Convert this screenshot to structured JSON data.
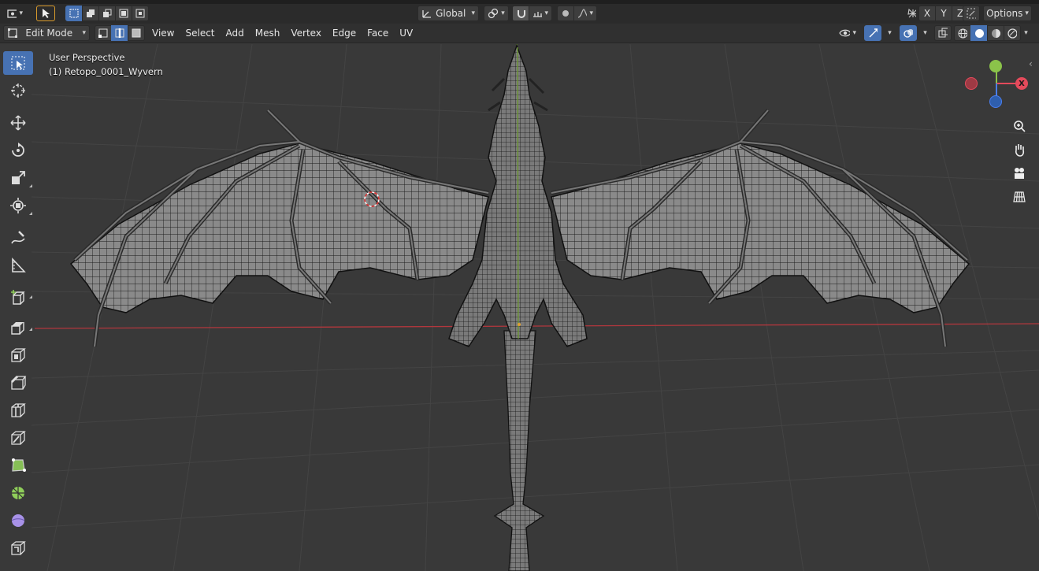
{
  "header_top": {
    "transform_orientation": "Global",
    "options_label": "Options",
    "axis_x": "X",
    "axis_y": "Y",
    "axis_z": "Z"
  },
  "header_edit": {
    "mode": "Edit Mode",
    "menus": [
      "View",
      "Select",
      "Add",
      "Mesh",
      "Vertex",
      "Edge",
      "Face",
      "UV"
    ]
  },
  "viewport": {
    "perspective_label": "User Perspective",
    "object_label": "(1) Retopo_0001_Wyvern"
  },
  "gizmo": {
    "x": "X",
    "y": "Y",
    "z": "Z",
    "x_color": "#e44a5b",
    "y_color": "#8bc34a",
    "z_color": "#4a7ef0"
  },
  "toolbar": {
    "tools": [
      "select-box",
      "cursor",
      "move",
      "rotate",
      "scale",
      "transform",
      "annotate",
      "measure",
      "add-cube",
      "extrude-region",
      "inset-faces",
      "bevel",
      "loop-cut",
      "knife",
      "poly-build",
      "spin",
      "smooth",
      "edge-slide",
      "shrink-fatten"
    ]
  },
  "colors": {
    "accent": "#4772b3",
    "x_axis_line": "#b2373d",
    "y_axis_line": "#6a9a2a",
    "background": "#393939"
  }
}
